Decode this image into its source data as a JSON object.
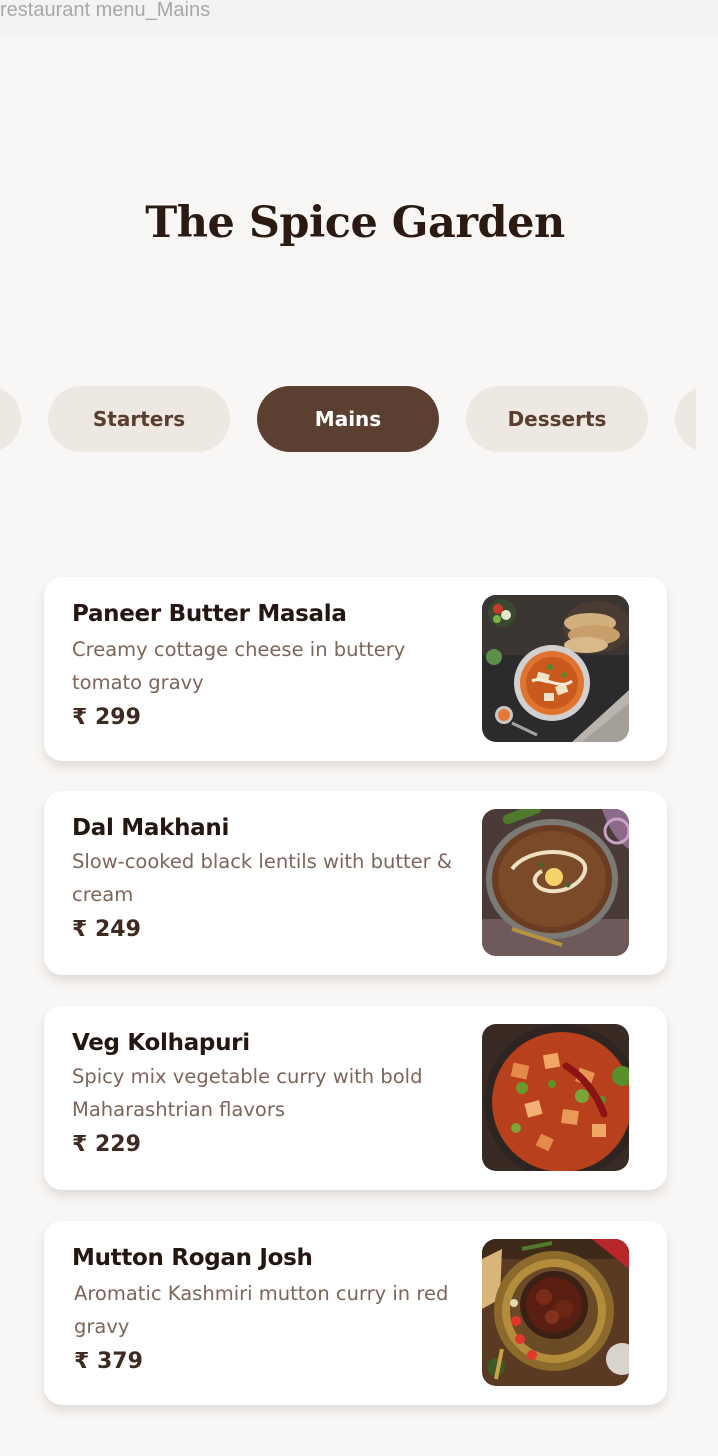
{
  "frame_label": "restaurant menu_Mains",
  "header": {
    "title": "The Spice Garden"
  },
  "tabs": [
    {
      "label": "Starters",
      "active": false
    },
    {
      "label": "Mains",
      "active": true
    },
    {
      "label": "Desserts",
      "active": false
    }
  ],
  "menu_items": [
    {
      "name": "Paneer Butter Masala",
      "description": "Creamy cottage cheese in buttery tomato gravy",
      "price": "₹ 299"
    },
    {
      "name": "Dal Makhani",
      "description": "Slow-cooked black lentils with butter & cream",
      "price": "₹ 249"
    },
    {
      "name": "Veg Kolhapuri",
      "description": "Spicy mix vegetable curry with bold Maharashtrian flavors",
      "price": "₹ 229"
    },
    {
      "name": "Mutton Rogan Josh",
      "description": "Aromatic Kashmiri mutton curry in red gravy",
      "price": "₹ 379"
    }
  ],
  "colors": {
    "background": "#f9f7f5",
    "tab_inactive": "#eee8e2",
    "tab_active": "#5b3f31",
    "card": "#ffffff",
    "title": "#2a1a12",
    "description": "#7d6559",
    "price": "#3e2a20"
  }
}
